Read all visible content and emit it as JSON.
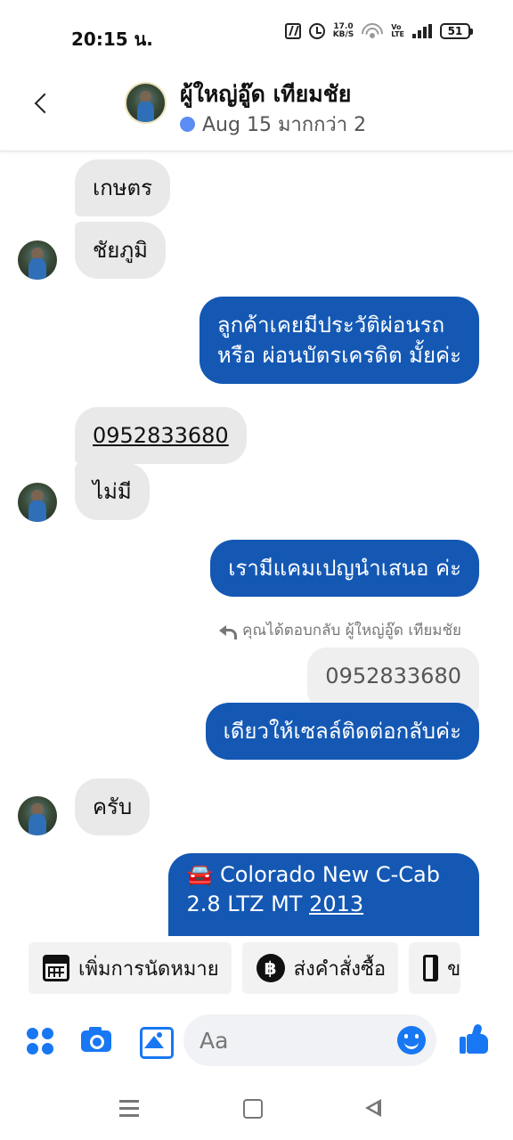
{
  "status_bar": {
    "time": "20:15 น.",
    "net_speed_value": "17.0",
    "net_speed_unit": "KB/S",
    "volte_top": "Vo",
    "volte_bottom": "LTE",
    "battery": "51"
  },
  "header": {
    "contact_name": "ผู้ใหญ่อู๊ด เทียมชัย",
    "active_status": "Aug 15 มากกว่า 2",
    "active_dot_color": "#5b8ef5"
  },
  "messages": [
    {
      "side": "in",
      "text": "เกษตร"
    },
    {
      "side": "in",
      "text": "ชัยภูมิ"
    },
    {
      "side": "out",
      "lines": [
        "ลูกค้าเคยมีประวัติผ่อนรถ",
        "หรือ ผ่อนบัตรเครดิต มั้ยค่ะ"
      ]
    },
    {
      "side": "in",
      "text": "0952833680"
    },
    {
      "side": "in",
      "text": "ไม่มี"
    },
    {
      "side": "out",
      "text": "เรามีแคมเปญนำเสนอ ค่ะ"
    },
    {
      "side": "reply_note",
      "text": "คุณได้ตอบกลับ ผู้ใหญ่อู๊ด เทียมชัย"
    },
    {
      "side": "out_quoted",
      "text": "0952833680"
    },
    {
      "side": "out",
      "text": "เดียวให้เซลล์ติดต่อกลับค่ะ"
    },
    {
      "side": "in",
      "text": "ครับ"
    },
    {
      "side": "out",
      "lines": [
        "🚘 Colorado New C-Cab",
        "2.8 LTZ MT "
      ],
      "link_text": "2013"
    }
  ],
  "suggestions": [
    {
      "label": "เพิ่มการนัดหมาย",
      "icon": "calendar-icon"
    },
    {
      "label": "ส่งคำสั่งซื้อ",
      "icon": "baht-icon",
      "icon_glyph": "฿"
    },
    {
      "label": "ข",
      "icon": "map-icon"
    }
  ],
  "composer": {
    "placeholder": "Aa",
    "accent_color": "#1877f2"
  },
  "colors": {
    "outgoing_bubble": "#1458b4",
    "incoming_bubble": "#e9e9e9"
  }
}
